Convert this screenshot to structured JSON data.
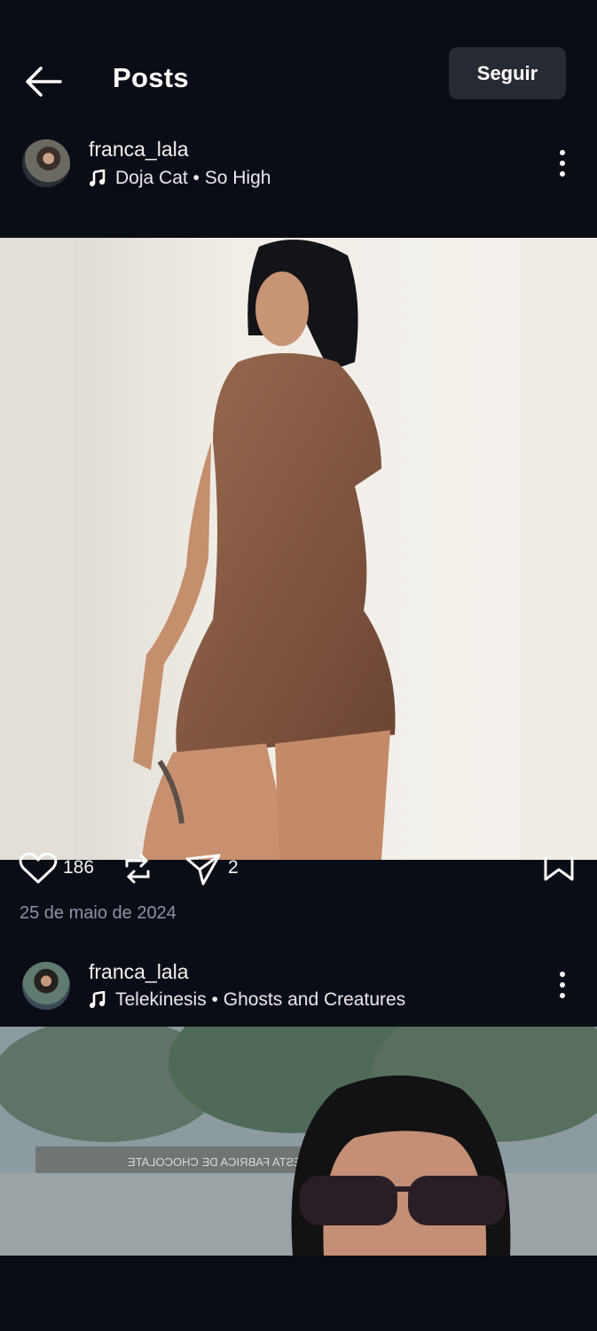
{
  "header": {
    "title": "Posts",
    "follow_label": "Seguir"
  },
  "posts": [
    {
      "username": "franca_lala",
      "music": "Doja Cat • So High",
      "likes": "186",
      "shares": "2",
      "date": "25 de maio de 2024"
    },
    {
      "username": "franca_lala",
      "music": "Telekinesis • Ghosts and Creatures"
    }
  ],
  "photo2_sign_text": "ESTA FABRICA DE CHOCOLATE",
  "colors": {
    "background": "#0b0d16",
    "button_bg": "#262a33",
    "muted_text": "#8f93a1"
  },
  "icons": [
    "back-arrow-icon",
    "more-vertical-icon",
    "music-note-icon",
    "heart-icon",
    "repost-icon",
    "send-icon",
    "bookmark-icon"
  ]
}
